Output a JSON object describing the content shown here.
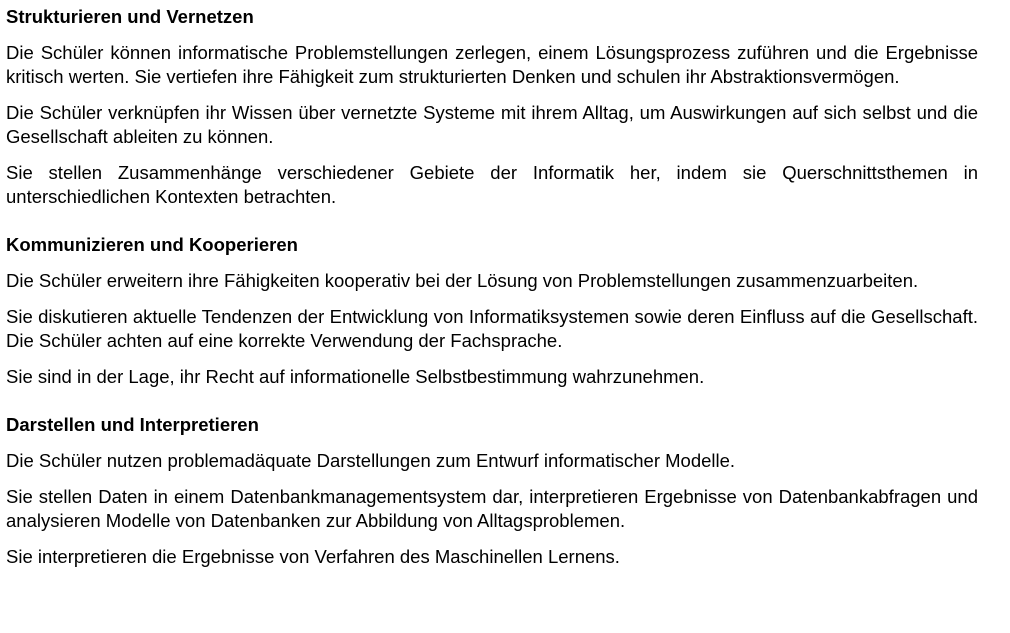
{
  "sections": [
    {
      "heading": "Strukturieren und Vernetzen",
      "paragraphs": [
        "Die Schüler können informatische Problemstellungen zerlegen, einem Lösungsprozess zuführen und die Ergebnisse kritisch werten. Sie vertiefen ihre Fähigkeit zum strukturierten Denken und schulen ihr Abs­traktionsvermögen.",
        "Die Schüler verknüpfen ihr Wissen über vernetzte Systeme mit ihrem Alltag, um Auswirkungen auf sich selbst und die Gesellschaft ableiten zu können.",
        "Sie stellen Zusammenhänge verschiedener Gebiete der Informatik her, indem sie Querschnittsthemen in unterschiedlichen Kontexten betrachten."
      ]
    },
    {
      "heading": "Kommunizieren und Kooperieren",
      "paragraphs": [
        "Die Schüler erweitern ihre Fähigkeiten kooperativ bei der Lösung von Problemstellungen zusammenzu­arbeiten.",
        "Sie diskutieren aktuelle Tendenzen der Entwicklung von Informatiksystemen sowie deren Einfluss auf die Gesellschaft. Die Schüler achten auf eine korrekte Verwendung der Fachsprache.",
        "Sie sind in der Lage, ihr Recht auf informationelle Selbstbestimmung wahrzunehmen."
      ]
    },
    {
      "heading": "Darstellen und Interpretieren",
      "paragraphs": [
        "Die Schüler nutzen problemadäquate Darstellungen zum Entwurf informatischer Modelle.",
        "Sie stellen Daten in einem Datenbankmanagementsystem dar, interpretieren Ergebnisse von Datenbank­abfragen und analysieren Modelle von Datenbanken zur Abbildung von Alltagsproblemen.",
        "Sie interpretieren die Ergebnisse von Verfahren des Maschinellen Lernens."
      ]
    }
  ]
}
